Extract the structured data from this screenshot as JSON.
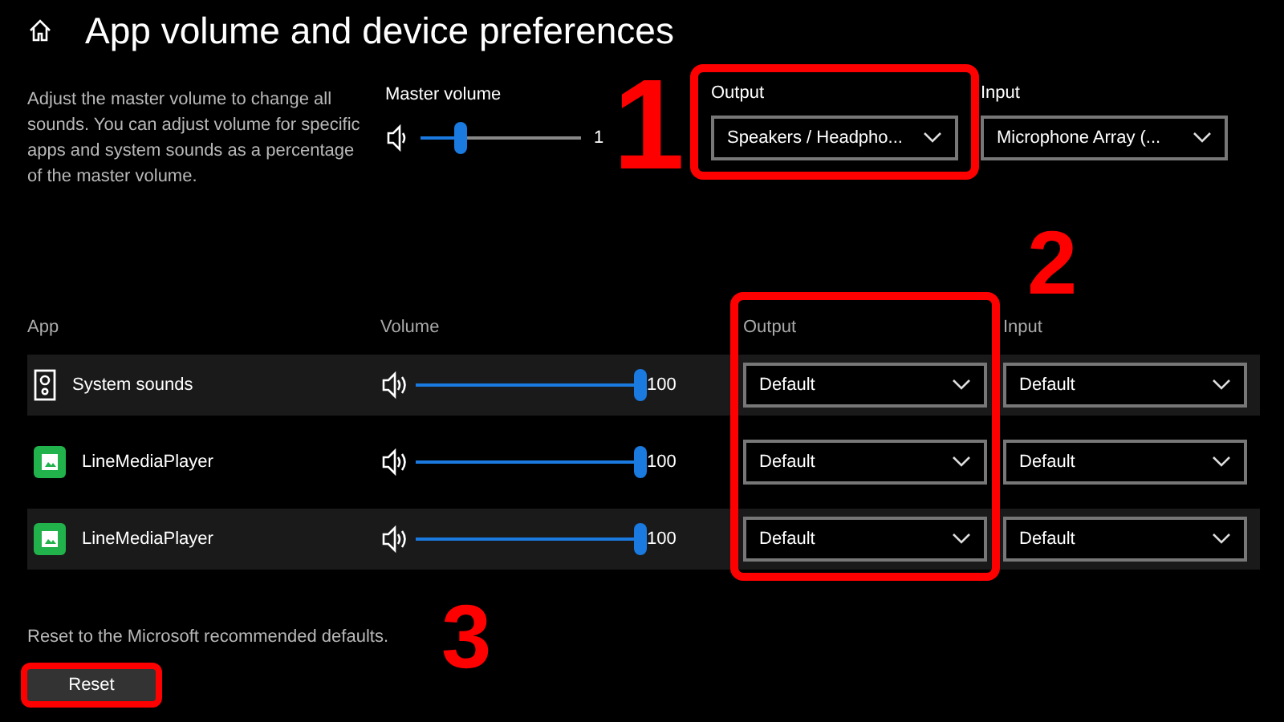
{
  "header": {
    "title": "App volume and device preferences"
  },
  "master": {
    "description": "Adjust the master volume to change all sounds. You can adjust volume for specific apps and system sounds as a percentage of the master volume.",
    "label": "Master volume",
    "level": 0.25,
    "reading": "1",
    "annotation": "1"
  },
  "devices": [
    {
      "label": "Output",
      "value": "Speakers / Headpho...",
      "highlighted": true
    },
    {
      "label": "Input",
      "value": "Microphone Array (...",
      "highlighted": false
    }
  ],
  "apps": {
    "columns": [
      "App",
      "Volume",
      "Output",
      "Input"
    ],
    "output_highlighted": true,
    "annotation": "2",
    "rows": [
      {
        "name": "System sounds",
        "kind": "system",
        "level": 1,
        "reading": "100",
        "output": "Default",
        "input": "Default"
      },
      {
        "name": "LineMediaPlayer",
        "kind": "app",
        "level": 1,
        "reading": "100",
        "output": "Default",
        "input": "Default"
      },
      {
        "name": "LineMediaPlayer",
        "kind": "app",
        "level": 1,
        "reading": "100",
        "output": "Default",
        "input": "Default"
      }
    ]
  },
  "reset": {
    "text": "Reset to the Microsoft recommended defaults.",
    "button": "Reset",
    "highlighted": true,
    "annotation": "3"
  }
}
